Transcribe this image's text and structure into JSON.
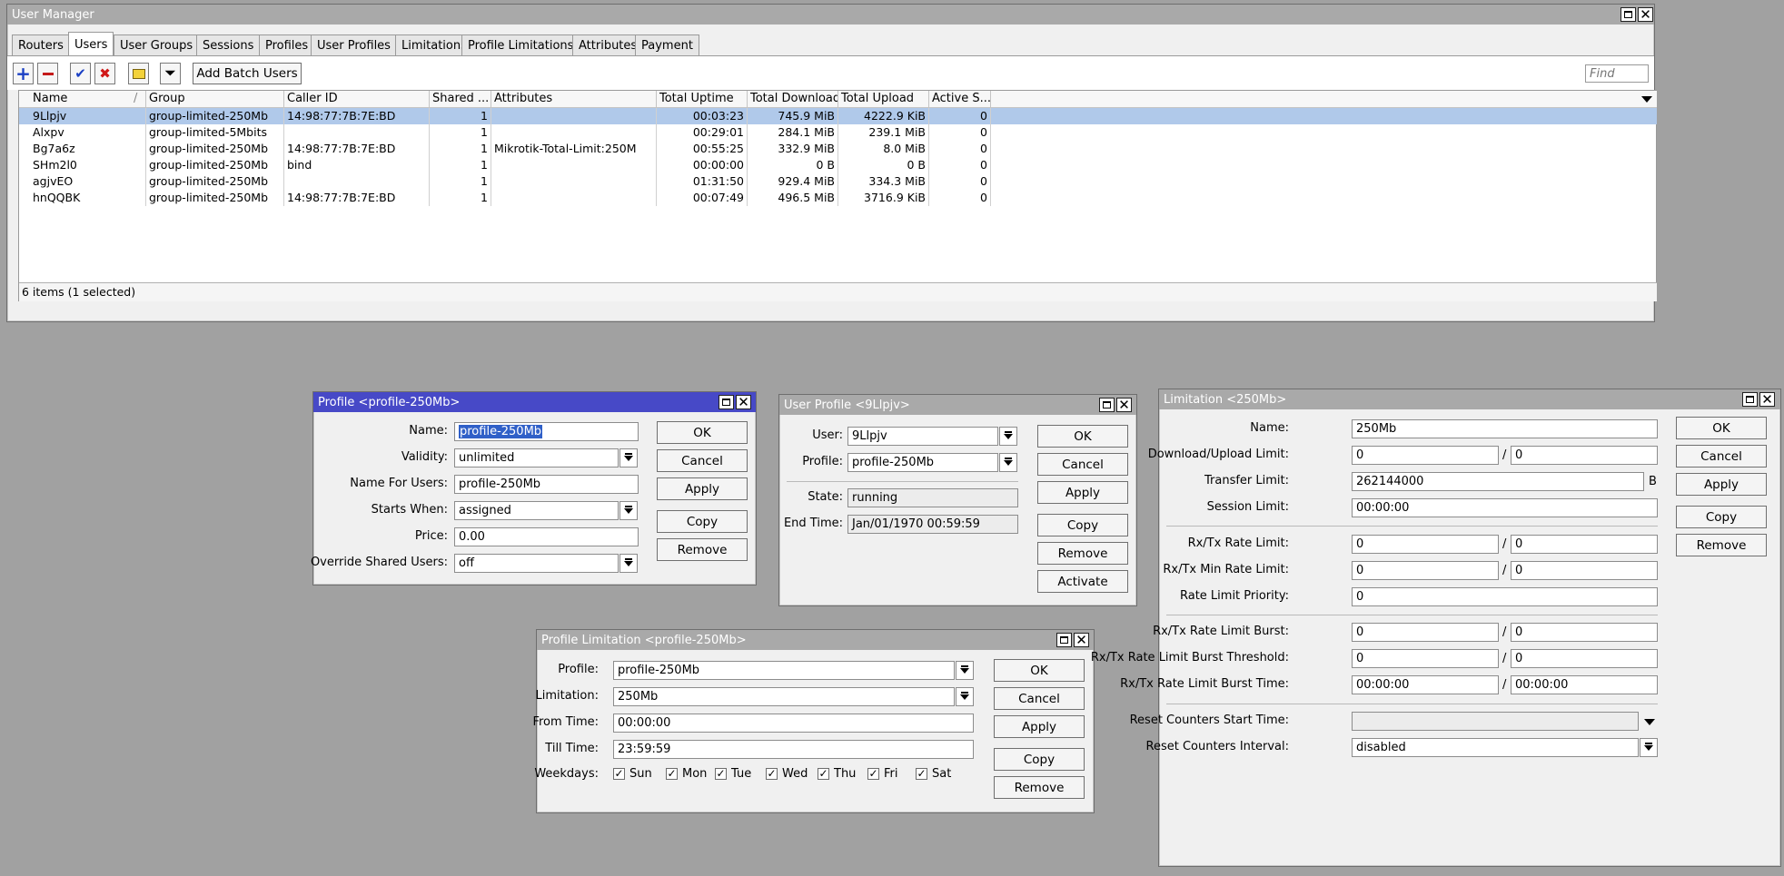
{
  "main": {
    "title": "User Manager",
    "tabs": [
      "Routers",
      "Users",
      "User Groups",
      "Sessions",
      "Profiles",
      "User Profiles",
      "Limitations",
      "Profile Limitations",
      "Attributes",
      "Payment"
    ],
    "add_batch_label": "Add Batch Users",
    "find_placeholder": "Find",
    "columns": [
      "Name",
      "Group",
      "Caller ID",
      "Shared ...",
      "Attributes",
      "Total Uptime",
      "Total Download",
      "Total Upload",
      "Active S..."
    ],
    "rows": [
      [
        "9Llpjv",
        "group-limited-250Mb",
        "14:98:77:7B:7E:BD",
        "1",
        "",
        "00:03:23",
        "745.9 MiB",
        "4222.9 KiB",
        "0"
      ],
      [
        "Alxpv",
        "group-limited-5Mbits",
        "",
        "1",
        "",
        "00:29:01",
        "284.1 MiB",
        "239.1 MiB",
        "0"
      ],
      [
        "Bg7a6z",
        "group-limited-250Mb",
        "14:98:77:7B:7E:BD",
        "1",
        "Mikrotik-Total-Limit:250M",
        "00:55:25",
        "332.9 MiB",
        "8.0 MiB",
        "0"
      ],
      [
        "SHm2l0",
        "group-limited-250Mb",
        "bind",
        "1",
        "",
        "00:00:00",
        "0 B",
        "0 B",
        "0"
      ],
      [
        "agjvEO",
        "group-limited-250Mb",
        "",
        "1",
        "",
        "01:31:50",
        "929.4 MiB",
        "334.3 MiB",
        "0"
      ],
      [
        "hnQQBK",
        "group-limited-250Mb",
        "14:98:77:7B:7E:BD",
        "1",
        "",
        "00:07:49",
        "496.5 MiB",
        "3716.9 KiB",
        "0"
      ]
    ],
    "status": "6 items (1 selected)"
  },
  "profile": {
    "title": "Profile <profile-250Mb>",
    "name_label": "Name:",
    "name": "profile-250Mb",
    "validity_label": "Validity:",
    "validity": "unlimited",
    "name_for_users_label": "Name For Users:",
    "name_for_users": "profile-250Mb",
    "starts_when_label": "Starts When:",
    "starts_when": "assigned",
    "price_label": "Price:",
    "price": "0.00",
    "override_label": "Override Shared Users:",
    "override": "off",
    "buttons": [
      "OK",
      "Cancel",
      "Apply",
      "Copy",
      "Remove"
    ]
  },
  "user_profile": {
    "title": "User Profile <9Llpjv>",
    "user_label": "User:",
    "user": "9Llpjv",
    "profile_label": "Profile:",
    "profile": "profile-250Mb",
    "state_label": "State:",
    "state": "running",
    "end_time_label": "End Time:",
    "end_time": "Jan/01/1970 00:59:59",
    "buttons": [
      "OK",
      "Cancel",
      "Apply",
      "Copy",
      "Remove",
      "Activate"
    ]
  },
  "profile_limitation": {
    "title": "Profile Limitation <profile-250Mb>",
    "profile_label": "Profile:",
    "profile": "profile-250Mb",
    "limitation_label": "Limitation:",
    "limitation": "250Mb",
    "from_label": "From Time:",
    "from": "00:00:00",
    "till_label": "Till Time:",
    "till": "23:59:59",
    "weekdays_label": "Weekdays:",
    "days": [
      "Sun",
      "Mon",
      "Tue",
      "Wed",
      "Thu",
      "Fri",
      "Sat"
    ],
    "buttons": [
      "OK",
      "Cancel",
      "Apply",
      "Copy",
      "Remove"
    ]
  },
  "limitation": {
    "title": "Limitation <250Mb>",
    "name_label": "Name:",
    "name": "250Mb",
    "dl_label": "Download/Upload Limit:",
    "dl": "0",
    "ul": "0",
    "transfer_label": "Transfer Limit:",
    "transfer": "262144000",
    "transfer_unit": "B",
    "session_label": "Session Limit:",
    "session": "00:00:00",
    "rate_label": "Rx/Tx Rate Limit:",
    "rate_rx": "0",
    "rate_tx": "0",
    "min_label": "Rx/Tx Min Rate Limit:",
    "min_rx": "0",
    "min_tx": "0",
    "prio_label": "Rate Limit Priority:",
    "prio": "0",
    "burst_label": "Rx/Tx Rate Limit Burst:",
    "burst_rx": "0",
    "burst_tx": "0",
    "thresh_label": "Rx/Tx Rate Limit Burst Threshold:",
    "thresh_rx": "0",
    "thresh_tx": "0",
    "btime_label": "Rx/Tx Rate Limit Burst Time:",
    "btime_rx": "00:00:00",
    "btime_tx": "00:00:00",
    "reset_start_label": "Reset Counters Start Time:",
    "reset_start": "",
    "reset_int_label": "Reset Counters Interval:",
    "reset_int": "disabled",
    "buttons": [
      "OK",
      "Cancel",
      "Apply",
      "Copy",
      "Remove"
    ]
  }
}
